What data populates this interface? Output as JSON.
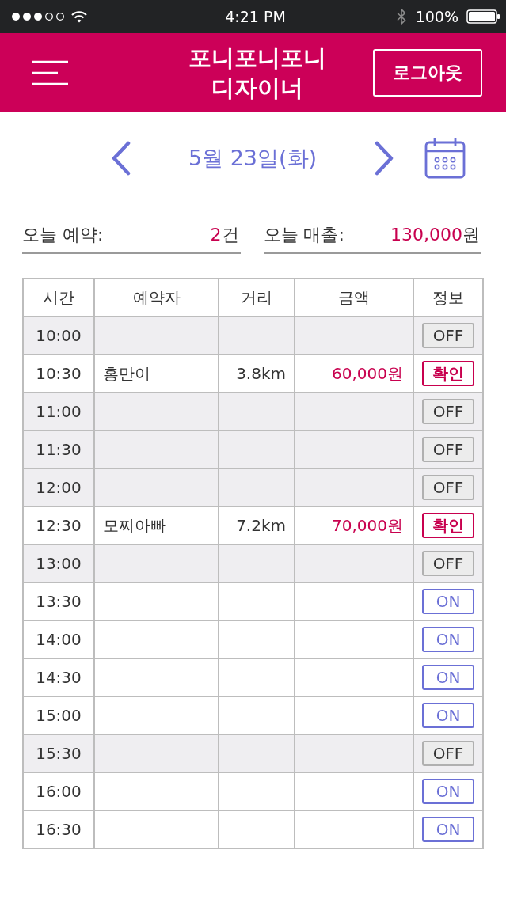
{
  "status_bar": {
    "time": "4:21 PM",
    "battery": "100%"
  },
  "header": {
    "title": "포니포니포니 디자이너",
    "logout_button": "로그아웃"
  },
  "date_nav": {
    "date": "5월 23일(화)"
  },
  "summary": [
    {
      "label": "오늘 예약:",
      "value": "2",
      "unit": "건"
    },
    {
      "label": "오늘 매출:",
      "value": "130,000",
      "unit": "원"
    }
  ],
  "table": {
    "columns": [
      "시간",
      "예약자",
      "거리",
      "금액",
      "정보"
    ],
    "rows": [
      {
        "time": "10:00",
        "kind": "off",
        "status": "OFF"
      },
      {
        "time": "10:30",
        "kind": "booked",
        "name": "홍만이",
        "distance": "3.8km",
        "amount": "60,000원",
        "status": "확인"
      },
      {
        "time": "11:00",
        "kind": "off",
        "status": "OFF"
      },
      {
        "time": "11:30",
        "kind": "off",
        "status": "OFF"
      },
      {
        "time": "12:00",
        "kind": "off",
        "status": "OFF"
      },
      {
        "time": "12:30",
        "kind": "booked",
        "name": "모찌아빠",
        "distance": "7.2km",
        "amount": "70,000원",
        "status": "확인"
      },
      {
        "time": "13:00",
        "kind": "off",
        "status": "OFF"
      },
      {
        "time": "13:30",
        "kind": "on",
        "status": "ON"
      },
      {
        "time": "14:00",
        "kind": "on",
        "status": "ON"
      },
      {
        "time": "14:30",
        "kind": "on",
        "status": "ON"
      },
      {
        "time": "15:00",
        "kind": "on",
        "status": "ON"
      },
      {
        "time": "15:30",
        "kind": "off",
        "status": "OFF"
      },
      {
        "time": "16:00",
        "kind": "on",
        "status": "ON"
      },
      {
        "time": "16:30",
        "kind": "on",
        "status": "ON"
      }
    ]
  }
}
